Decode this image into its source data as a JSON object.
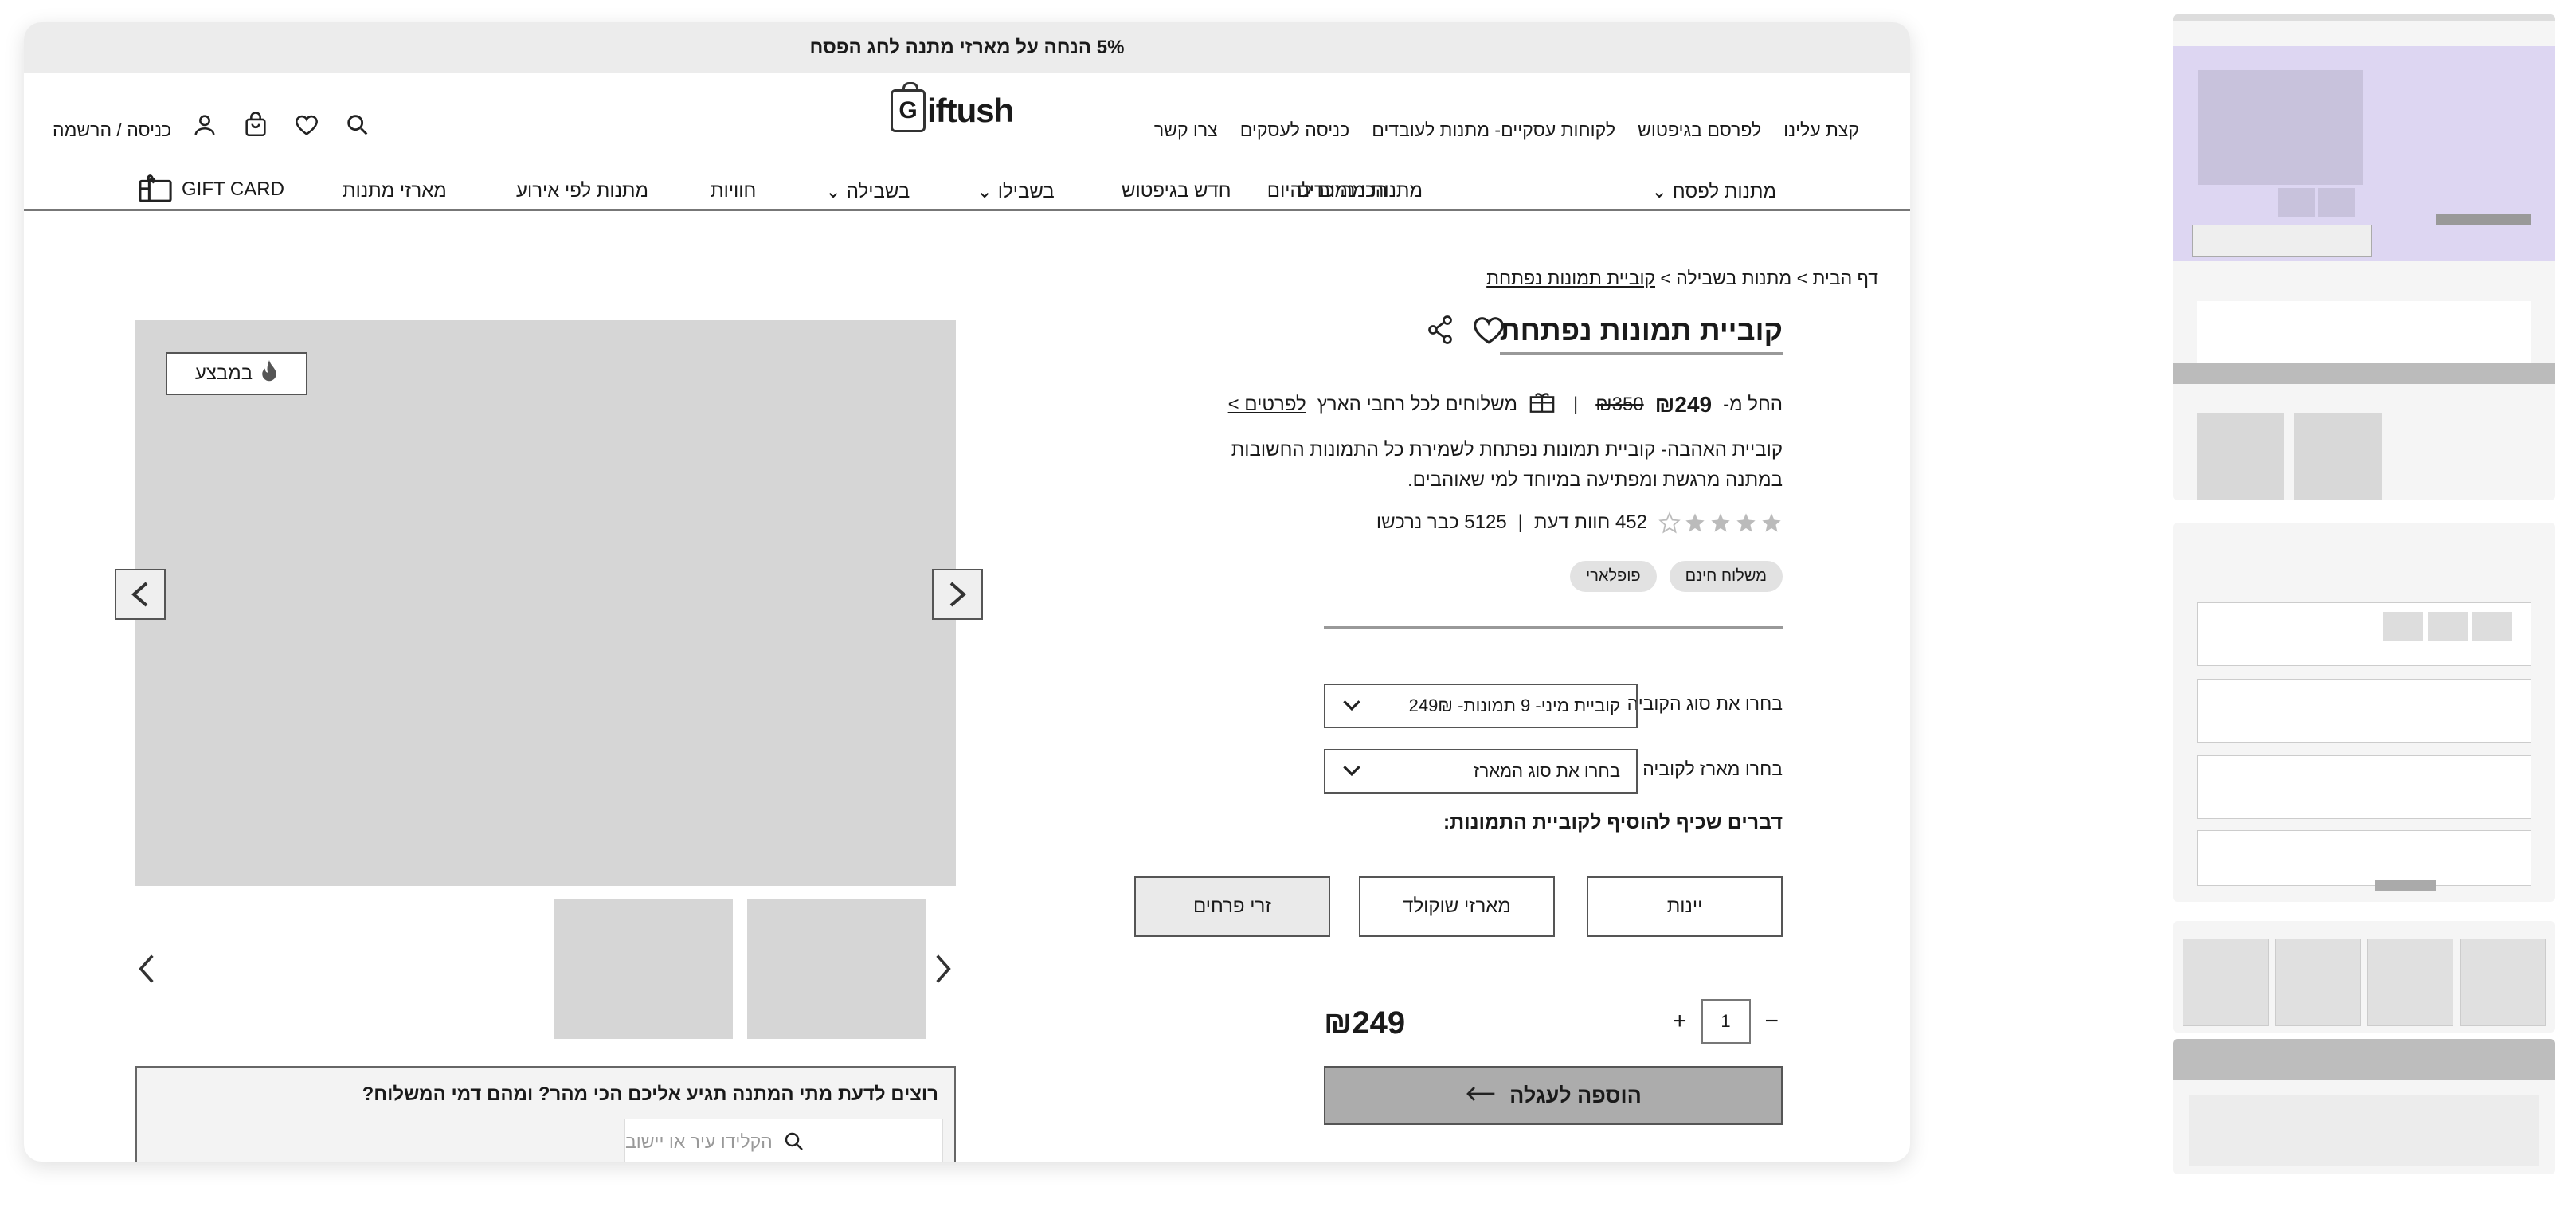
{
  "promo": {
    "text": "5% הנחה על מארזי מתנה לחג הפסח"
  },
  "header": {
    "logo_letter": "G",
    "logo_text": "iftush",
    "login_label": "כניסה / הרשמה",
    "utility_links": [
      "קצת עלינו",
      "לפרסם בגיפטוש",
      "לקוחות עסקיים- מתנות לעובדים",
      "כניסה לעסקים",
      "צרו קשר"
    ],
    "nav": {
      "passover": "מתנות לפסח",
      "today": "מתנות מהיום להיום",
      "bestsellers": "הכי נמכרים",
      "new": "חדש בגיפטוש",
      "for_him": "בשבילו",
      "for_her": "בשבילה",
      "experiences": "חוויות",
      "events": "מתנות לפי אירוע",
      "packages": "מארזי מתנות",
      "gift_card": "GIFT CARD"
    }
  },
  "breadcrumb": {
    "home": "דף הבית",
    "sep": ">",
    "category": "מתנות בשבילה",
    "current": "קוביית תמונות נפתחת"
  },
  "gallery": {
    "badge": "במבצע"
  },
  "shipping_widget": {
    "question": "רוצים לדעת מתי המתנה תגיע אליכם הכי מהר? ומהם דמי המשלוח?",
    "placeholder": "הקלידו עיר או יישוב"
  },
  "product": {
    "title": "קוביית תמונות נפתחת",
    "price_prefix": "החל מ-",
    "old_price": "₪350",
    "price": "₪249",
    "divider": "|",
    "shipping_text": "משלוחים לכל רחבי הארץ",
    "details_link": "לפרטים >",
    "description": "קוביית האהבה- קוביית תמונות נפתחת לשמירת כל התמונות החשובות במתנה מרגשת ומפתיעה במיוחד למי שאוהבים.",
    "rating": 0.8,
    "reviews": "452 חוות דעת",
    "purchased": "5125 כבר נרכשו",
    "tags": [
      "משלוח חינם",
      "פופלארי"
    ],
    "option1_label": "בחרו את סוג הקוביה",
    "option1_value": "קוביית מיני- 9 תמונות- 249₪",
    "option2_label": "בחרו מארז לקוביה",
    "option2_value": "בחרו את סוג המארז",
    "addons_title": "דברים שכיף להוסיף לקוביית התמונות:",
    "addons": [
      "יינות",
      "מארזי שוקולד",
      "זרי פרחים"
    ],
    "total": "₪249",
    "qty": "1",
    "qty_plus": "+",
    "qty_minus": "−",
    "add_to_cart": "הוספה לעגלה"
  },
  "colors": {
    "accent_gray": "#acacac",
    "border": "#555555",
    "placeholder": "#d6d6d6"
  }
}
